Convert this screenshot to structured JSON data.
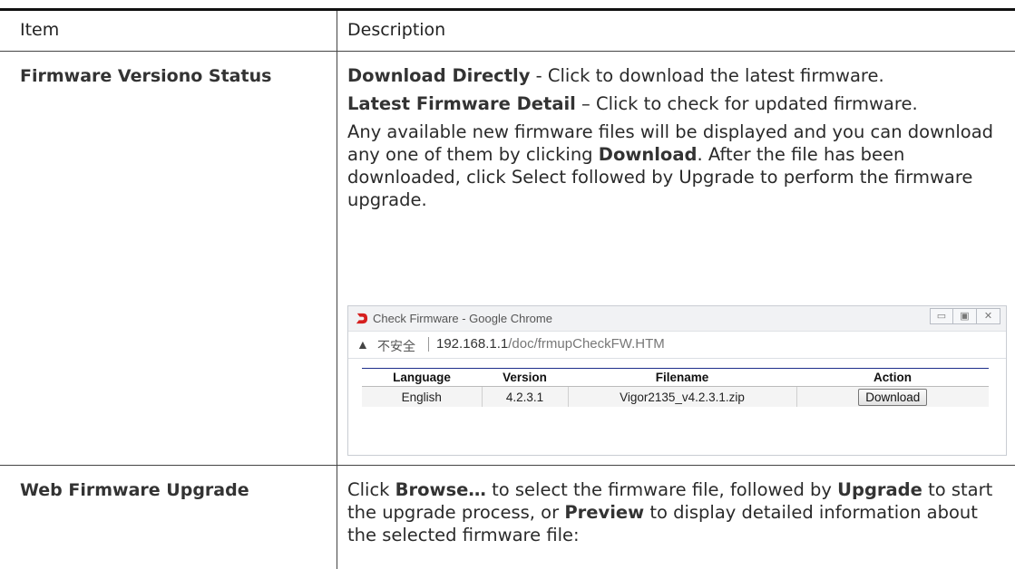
{
  "table": {
    "header_item": "Item",
    "header_description": "Description"
  },
  "rows": [
    {
      "item": "Firmware Versiono Status",
      "p1_bold": "Download Directly",
      "p1_rest": " - Click to download the latest firmware.",
      "p2_bold": "Latest Firmware Detail",
      "p2_rest": " – Click to check for updated firmware.",
      "p3_a": "Any available new firmware files will be displayed and you can download any one of them by clicking ",
      "p3_bold": "Download",
      "p3_b": ". After the file has been downloaded, click Select followed by Upgrade to perform the firmware upgrade."
    },
    {
      "item": "Web Firmware Upgrade",
      "p1_a": "Click ",
      "p1_bold1": "Browse…",
      "p1_b": " to select the firmware file, followed by ",
      "p1_bold2": "Upgrade",
      "p1_c": " to start the upgrade process, or ",
      "p1_bold3": "Preview",
      "p1_d": " to display detailed information about the selected firmware file:"
    }
  ],
  "popup": {
    "title": "Check Firmware - Google Chrome",
    "security_label": "不安全",
    "url_host": "192.168.1.1",
    "url_path": "/doc/frmupCheckFW.HTM",
    "columns": [
      "Language",
      "Version",
      "Filename",
      "Action"
    ],
    "row": {
      "language": "English",
      "version": "4.2.3.1",
      "filename": "Vigor2135_v4.2.3.1.zip",
      "action": "Download"
    }
  }
}
